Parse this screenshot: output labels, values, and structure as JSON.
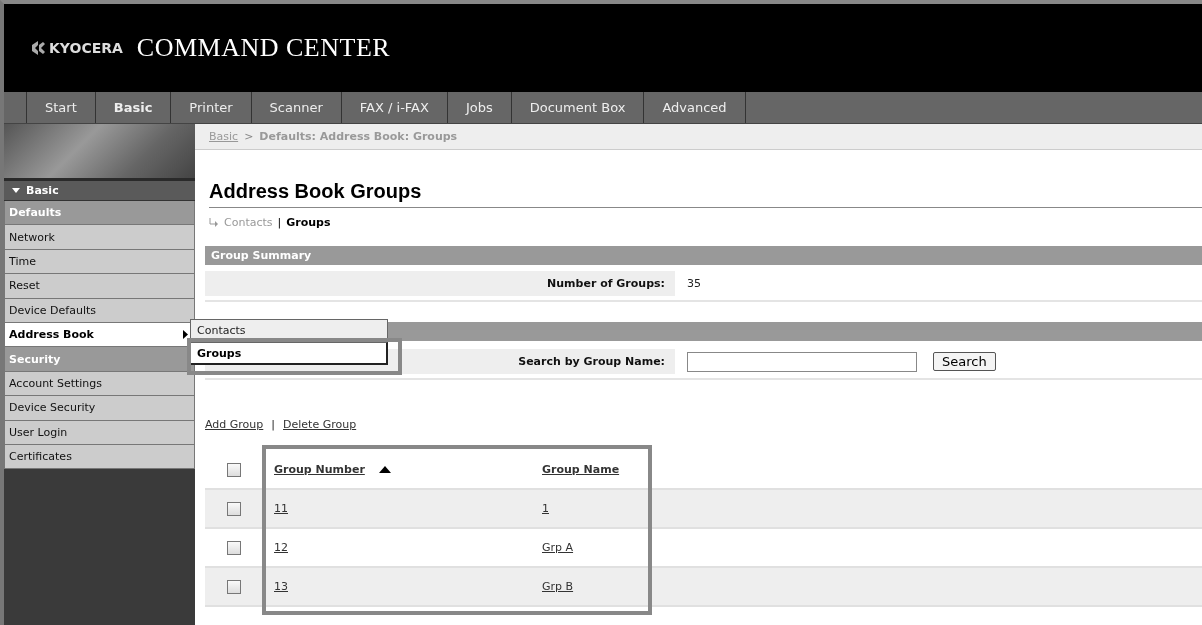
{
  "header": {
    "logo": "KYOCERA",
    "title": "COMMAND CENTER"
  },
  "tabs": [
    {
      "label": "Start",
      "selected": false
    },
    {
      "label": "Basic",
      "selected": true
    },
    {
      "label": "Printer",
      "selected": false
    },
    {
      "label": "Scanner",
      "selected": false
    },
    {
      "label": "FAX / i-FAX",
      "selected": false
    },
    {
      "label": "Jobs",
      "selected": false
    },
    {
      "label": "Document Box",
      "selected": false
    },
    {
      "label": "Advanced",
      "selected": false
    }
  ],
  "breadcrumb": {
    "link": "Basic",
    "separator": ">",
    "current": "Defaults: Address Book: Groups"
  },
  "sidebar": {
    "title": "Basic",
    "expanded": true,
    "items": [
      {
        "kind": "section",
        "label": "Defaults",
        "selected": false,
        "submenu": false
      },
      {
        "kind": "item",
        "label": "Network",
        "selected": false,
        "submenu": false
      },
      {
        "kind": "item",
        "label": "Time",
        "selected": false,
        "submenu": false
      },
      {
        "kind": "item",
        "label": "Reset",
        "selected": false,
        "submenu": false
      },
      {
        "kind": "item",
        "label": "Device Defaults",
        "selected": false,
        "submenu": false
      },
      {
        "kind": "item",
        "label": "Address Book",
        "selected": true,
        "submenu": true
      },
      {
        "kind": "section",
        "label": "Security",
        "selected": false,
        "submenu": false
      },
      {
        "kind": "item",
        "label": "Account Settings",
        "selected": false,
        "submenu": false
      },
      {
        "kind": "item",
        "label": "Device Security",
        "selected": false,
        "submenu": false
      },
      {
        "kind": "item",
        "label": "User Login",
        "selected": false,
        "submenu": false
      },
      {
        "kind": "item",
        "label": "Certificates",
        "selected": false,
        "submenu": false
      }
    ]
  },
  "submenu": [
    {
      "label": "Contacts",
      "selected": false,
      "highlighted": false
    },
    {
      "label": "Groups",
      "selected": true,
      "highlighted": true
    }
  ],
  "page_title": "Address Book Groups",
  "subnav": [
    {
      "label": "Contacts",
      "selected": false
    },
    {
      "label": "Groups",
      "selected": true
    }
  ],
  "subnav_separator": "|",
  "summary": {
    "title": "Group Summary",
    "label": "Number of Groups:",
    "value": "35"
  },
  "search": {
    "label": "Search by Group Name:",
    "button": "Search"
  },
  "actions": [
    "Add Group",
    "Delete Group"
  ],
  "actions_separator": "|",
  "table": {
    "highlighted": true,
    "header_checked": false,
    "columns": [
      {
        "label": "Group Number",
        "sorted": true
      },
      {
        "label": "Group Name"
      }
    ],
    "rows": [
      {
        "checked": false,
        "cells": [
          "11",
          "1"
        ]
      },
      {
        "checked": false,
        "cells": [
          "12",
          "Grp A"
        ]
      },
      {
        "checked": false,
        "cells": [
          "13",
          "Grp B"
        ]
      }
    ]
  }
}
